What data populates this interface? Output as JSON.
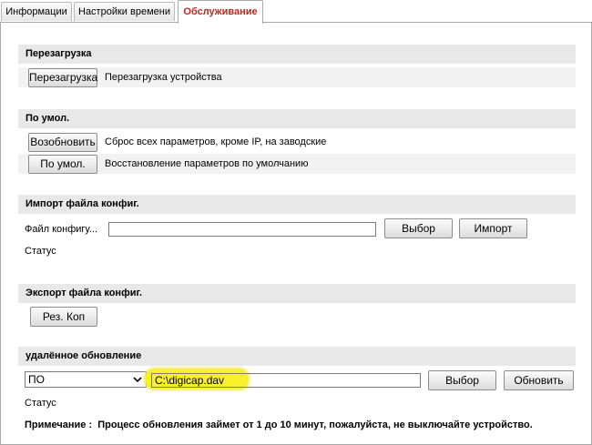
{
  "tabs": [
    {
      "label": "Информации",
      "active": false
    },
    {
      "label": "Настройки времени",
      "active": false
    },
    {
      "label": "Обслуживание",
      "active": true
    }
  ],
  "colors": {
    "active_tab_text": "#b8291d",
    "section_header_bg": "#e8e8e8",
    "highlight": "#f7f02a"
  },
  "reboot": {
    "title": "Перезагрузка",
    "button": "Перезагрузка",
    "description": "Перезагрузка устройства"
  },
  "defaults": {
    "title": "По умол.",
    "restore_button": "Возобновить",
    "restore_description": "Сброс всех параметров, кроме IP, на заводские",
    "default_button": "По умол.",
    "default_description": "Восстановление параметров по умолчанию"
  },
  "import_config": {
    "title": "Импорт файла конфиг.",
    "file_label": "Файл конфигу...",
    "file_value": "",
    "browse_button": "Выбор",
    "import_button": "Импорт",
    "status_label": "Статус"
  },
  "export_config": {
    "title": "Экспорт файла конфиг.",
    "backup_button": "Рез. Коп"
  },
  "remote_upgrade": {
    "title": "удалённое обновление",
    "type_selected": "ПО",
    "file_value": "C:\\digicap.dav",
    "browse_button": "Выбор",
    "upgrade_button": "Обновить",
    "status_label": "Статус",
    "note_label": "Примечание :",
    "note_text": "Процесс обновления займет от 1 до 10 минут, пожалуйста, не выключайте устройство."
  }
}
